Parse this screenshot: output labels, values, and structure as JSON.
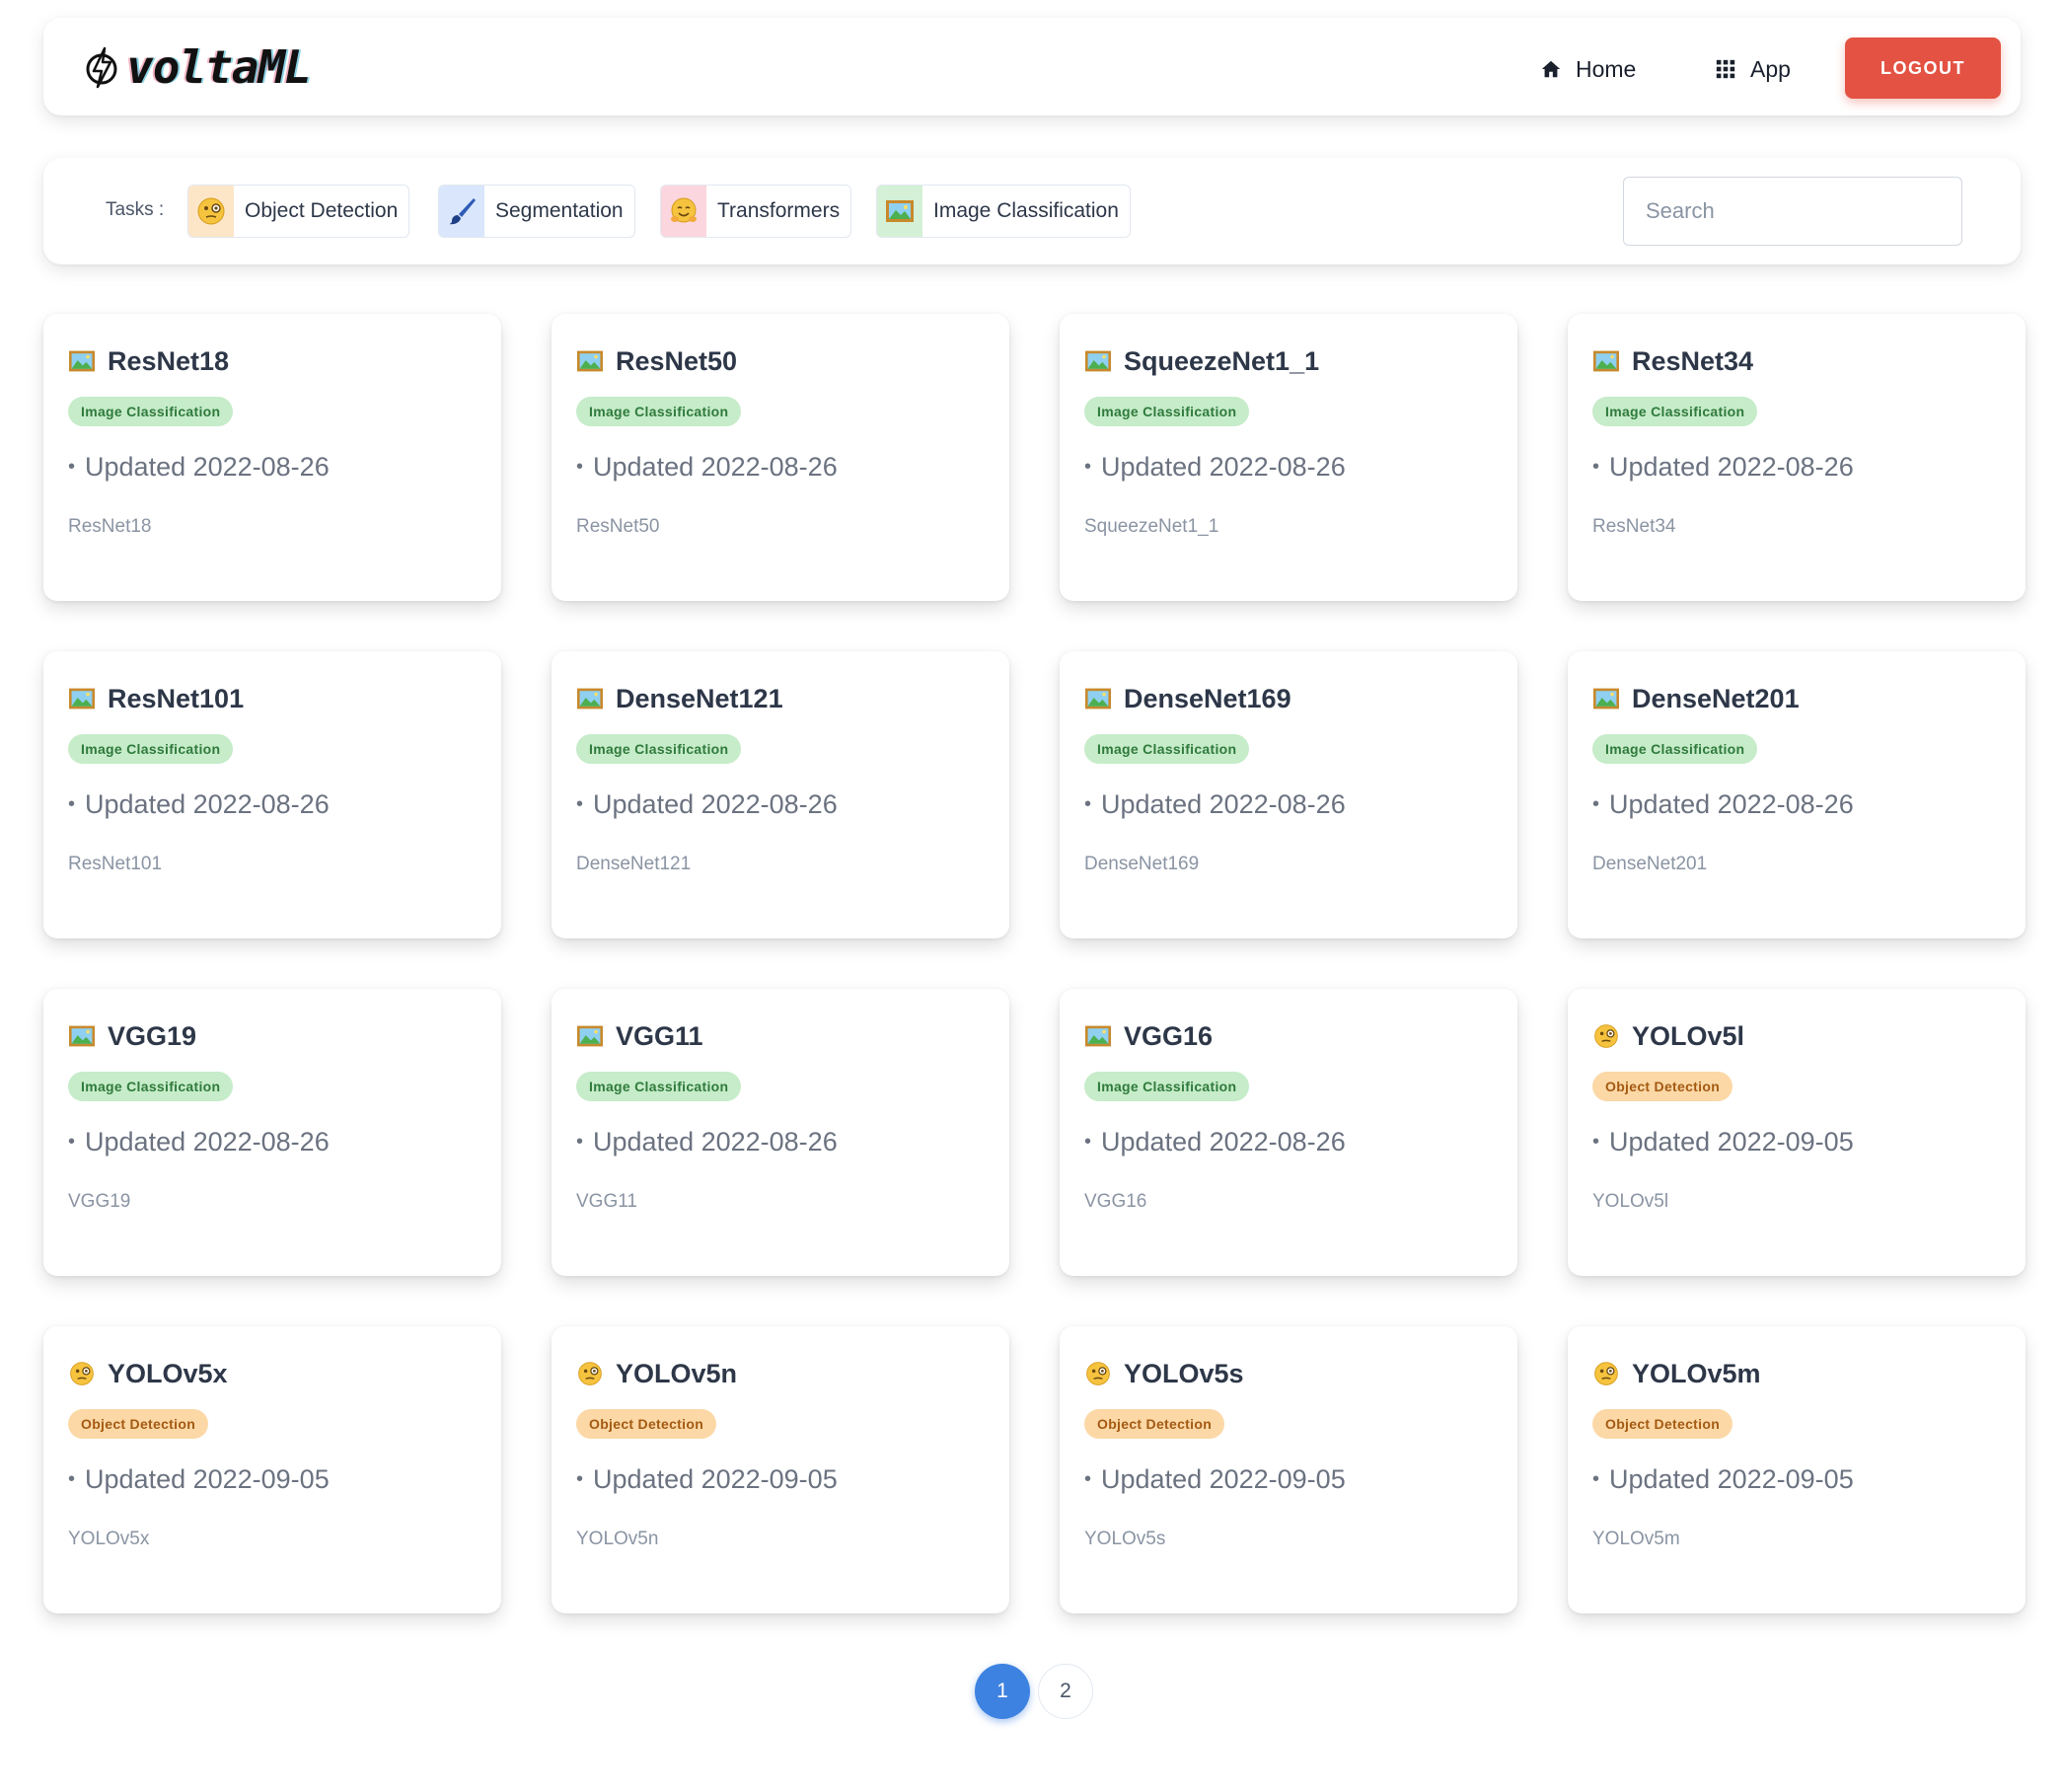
{
  "app": {
    "logo_text": "voltaML"
  },
  "nav": {
    "home_label": "Home",
    "app_label": "App",
    "logout_label": "LOGOUT",
    "home_icon": "home-icon",
    "app_icon": "grid-icon"
  },
  "tasks": {
    "label": "Tasks :",
    "chips": [
      {
        "label": "Object Detection",
        "icon": "face-monocle-icon",
        "icon_bg": "#fde6c8"
      },
      {
        "label": "Segmentation",
        "icon": "paintbrush-icon",
        "icon_bg": "#d9e6fb"
      },
      {
        "label": "Transformers",
        "icon": "hugging-face-icon",
        "icon_bg": "#fbd6de"
      },
      {
        "label": "Image Classification",
        "icon": "framed-picture-icon",
        "icon_bg": "#d4f0d6"
      }
    ],
    "search_placeholder": "Search"
  },
  "models": [
    {
      "title": "ResNet18",
      "badge": "Image Classification",
      "updated": "Updated 2022-08-26",
      "subtitle": "ResNet18"
    },
    {
      "title": "ResNet50",
      "badge": "Image Classification",
      "updated": "Updated 2022-08-26",
      "subtitle": "ResNet50"
    },
    {
      "title": "SqueezeNet1_1",
      "badge": "Image Classification",
      "updated": "Updated 2022-08-26",
      "subtitle": "SqueezeNet1_1"
    },
    {
      "title": "ResNet34",
      "badge": "Image Classification",
      "updated": "Updated 2022-08-26",
      "subtitle": "ResNet34"
    },
    {
      "title": "ResNet101",
      "badge": "Image Classification",
      "updated": "Updated 2022-08-26",
      "subtitle": "ResNet101"
    },
    {
      "title": "DenseNet121",
      "badge": "Image Classification",
      "updated": "Updated 2022-08-26",
      "subtitle": "DenseNet121"
    },
    {
      "title": "DenseNet169",
      "badge": "Image Classification",
      "updated": "Updated 2022-08-26",
      "subtitle": "DenseNet169"
    },
    {
      "title": "DenseNet201",
      "badge": "Image Classification",
      "updated": "Updated 2022-08-26",
      "subtitle": "DenseNet201"
    },
    {
      "title": "VGG19",
      "badge": "Image Classification",
      "updated": "Updated 2022-08-26",
      "subtitle": "VGG19"
    },
    {
      "title": "VGG11",
      "badge": "Image Classification",
      "updated": "Updated 2022-08-26",
      "subtitle": "VGG11"
    },
    {
      "title": "VGG16",
      "badge": "Image Classification",
      "updated": "Updated 2022-08-26",
      "subtitle": "VGG16"
    },
    {
      "title": "YOLOv5l",
      "badge": "Object Detection",
      "updated": "Updated 2022-09-05",
      "subtitle": "YOLOv5l"
    },
    {
      "title": "YOLOv5x",
      "badge": "Object Detection",
      "updated": "Updated 2022-09-05",
      "subtitle": "YOLOv5x"
    },
    {
      "title": "YOLOv5n",
      "badge": "Object Detection",
      "updated": "Updated 2022-09-05",
      "subtitle": "YOLOv5n"
    },
    {
      "title": "YOLOv5s",
      "badge": "Object Detection",
      "updated": "Updated 2022-09-05",
      "subtitle": "YOLOv5s"
    },
    {
      "title": "YOLOv5m",
      "badge": "Object Detection",
      "updated": "Updated 2022-09-05",
      "subtitle": "YOLOv5m"
    }
  ],
  "pagination": {
    "pages": [
      "1",
      "2"
    ],
    "current": "1"
  },
  "colors": {
    "accent_logout": "#e35242",
    "pagination_active": "#3d82e0",
    "badge_image_classification_bg": "#c6ecc9",
    "badge_image_classification_text": "#2f7a3c",
    "badge_object_detection_bg": "#fbd8a6",
    "badge_object_detection_text": "#a35a12"
  }
}
